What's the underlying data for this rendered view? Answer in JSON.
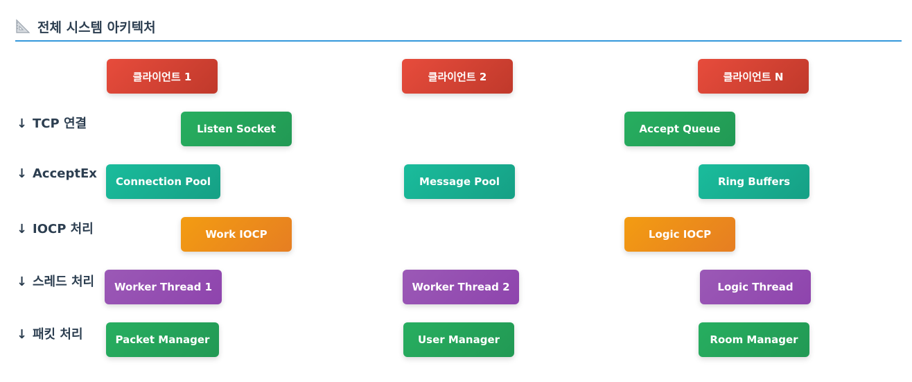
{
  "header": {
    "icon": "triangle-ruler-icon",
    "title": "전체 시스템 아키텍처"
  },
  "rows": [
    {
      "arrow": "↓",
      "label": "TCP 연결"
    },
    {
      "arrow": "↓",
      "label": "AcceptEx"
    },
    {
      "arrow": "↓",
      "label": "IOCP 처리"
    },
    {
      "arrow": "↓",
      "label": "스레드 처리"
    },
    {
      "arrow": "↓",
      "label": "패킷 처리"
    }
  ],
  "nodes": {
    "clients": [
      "클라이언트 1",
      "클라이언트 2",
      "클라이언트 N"
    ],
    "sockets": [
      "Listen Socket",
      "Accept Queue"
    ],
    "pools": [
      "Connection Pool",
      "Message Pool",
      "Ring Buffers"
    ],
    "iocp": [
      "Work IOCP",
      "Logic IOCP"
    ],
    "threads": [
      "Worker Thread 1",
      "Worker Thread 2",
      "Logic Thread"
    ],
    "managers": [
      "Packet Manager",
      "User Manager",
      "Room Manager"
    ]
  },
  "colors": {
    "accent": "#3498db",
    "text": "#2c3e50",
    "client": "#e74c3c",
    "socket": "#27ae60",
    "pool": "#1abc9c",
    "iocp": "#f39c12",
    "thread": "#9b59b6",
    "manager": "#27ae60"
  }
}
